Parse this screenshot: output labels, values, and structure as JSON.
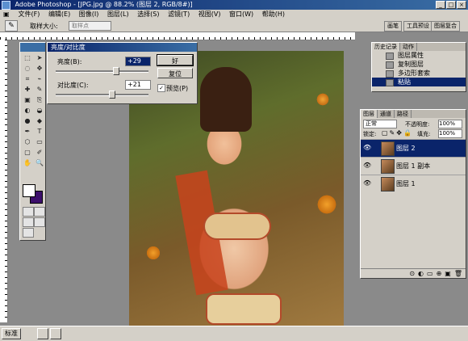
{
  "window": {
    "title": "Adobe Photoshop - [JPG.jpg @ 88.2% (图层 2, RGB/8#)]",
    "buttons": [
      "_",
      "□",
      "×"
    ]
  },
  "menu": [
    "文件(F)",
    "编辑(E)",
    "图像(I)",
    "图层(L)",
    "选择(S)",
    "滤镜(T)",
    "视图(V)",
    "窗口(W)",
    "帮助(H)"
  ],
  "options": {
    "tool_glyph": "✎",
    "label": "取样大小:",
    "select_value": "取样点",
    "wells": [
      "画笔",
      "工具预设",
      "图层复合"
    ]
  },
  "tools": [
    "⬚",
    "➤",
    "◌",
    "✥",
    "⌗",
    "⌁",
    "✚",
    "✎",
    "▣",
    "⎘",
    "◐",
    "◒",
    "●",
    "◆",
    "✒",
    "T",
    "⬡",
    "▭",
    "▢",
    "✐",
    "✋",
    "🔍"
  ],
  "colors": {
    "foreground": "#ffffff",
    "background": "#3c0f6b",
    "titlebar": "#0a246a"
  },
  "dialog": {
    "title": "亮度/对比度",
    "brightness_label": "亮度(B):",
    "brightness_value": "+29",
    "contrast_label": "对比度(C):",
    "contrast_value": "+21",
    "ok_label": "好",
    "reset_label": "复位",
    "preview_label": "预览(P)",
    "preview_checked": "✓",
    "brightness_level": 0.64,
    "contrast_level": 0.6
  },
  "history_panel": {
    "tabs": [
      "历史记录",
      "动作"
    ],
    "items": [
      {
        "label": "图层属性"
      },
      {
        "label": "复制图层"
      },
      {
        "label": "多边形套索"
      },
      {
        "label": "粘贴"
      }
    ],
    "active_index": 3
  },
  "layers_panel": {
    "tabs": [
      "图层",
      "通道",
      "路径"
    ],
    "blend_mode": "正常",
    "opacity_label": "不透明度:",
    "opacity_value": "100%",
    "lock_label": "锁定:",
    "fill_label": "填充:",
    "fill_value": "100%",
    "layers": [
      {
        "name": "图层 2"
      },
      {
        "name": "图层 1 副本"
      },
      {
        "name": "图层 1"
      }
    ],
    "active_index": 0
  },
  "taskbar": {
    "items": [
      "标准"
    ]
  }
}
